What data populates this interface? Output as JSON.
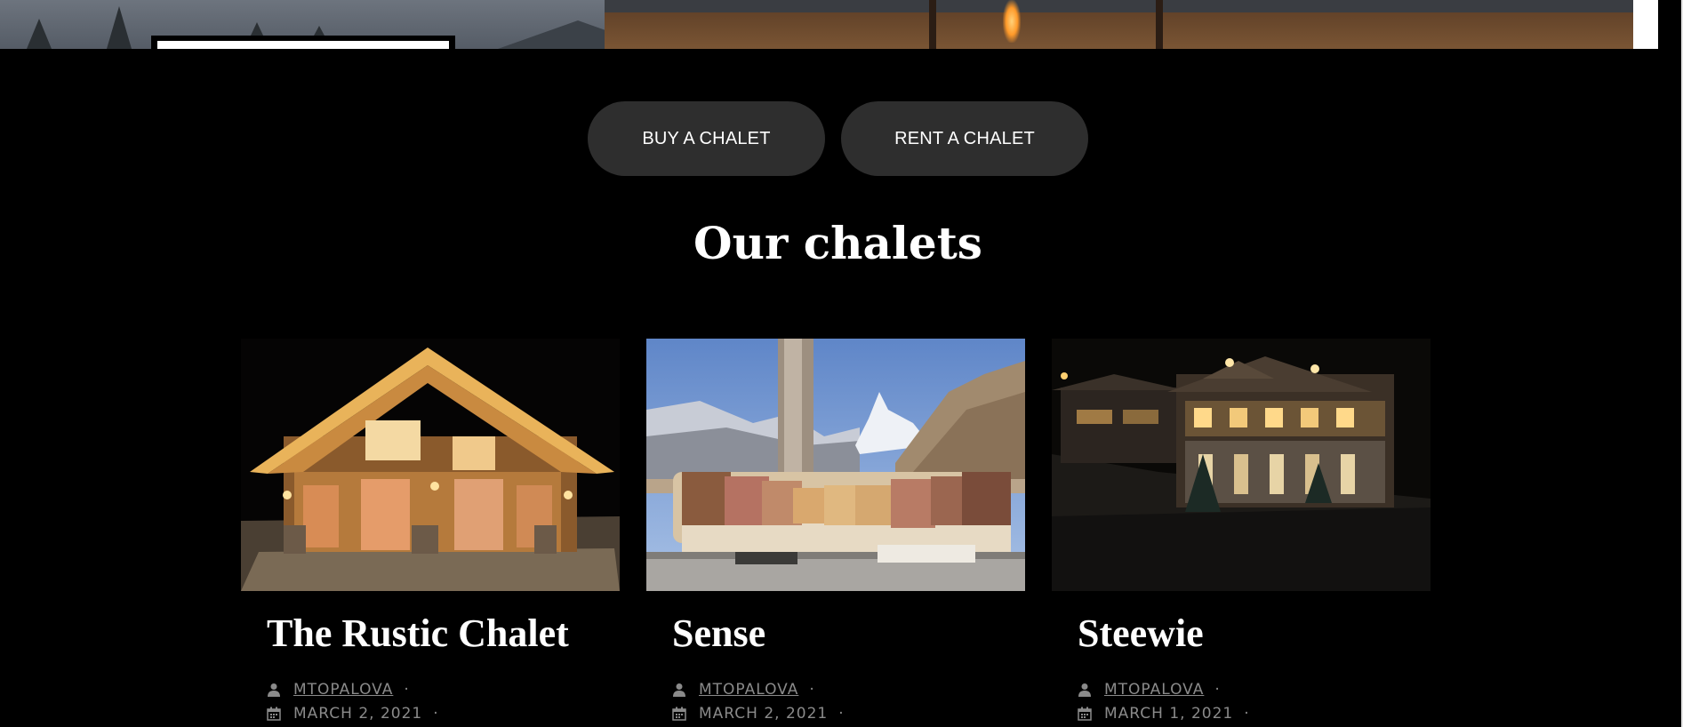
{
  "nav_buttons": {
    "buy_label": "BUY A CHALET",
    "rent_label": "RENT A CHALET"
  },
  "section": {
    "title": "Our chalets"
  },
  "cards": [
    {
      "title": "The Rustic Chalet",
      "author": "MTOPALOVA",
      "date": "MARCH 2, 2021",
      "separator": "·",
      "image_icon": "chalet-night-photo"
    },
    {
      "title": "Sense",
      "author": "MTOPALOVA",
      "date": "MARCH 2, 2021",
      "separator": "·",
      "image_icon": "living-room-mountain-view-photo"
    },
    {
      "title": "Steewie",
      "author": "MTOPALOVA",
      "date": "MARCH 1, 2021",
      "separator": "·",
      "image_icon": "chalet-lit-at-night-photo"
    }
  ],
  "colors": {
    "background": "#000000",
    "button_bg": "#2e2e2e",
    "text": "#ffffff",
    "meta_text": "#8a8a8a"
  }
}
